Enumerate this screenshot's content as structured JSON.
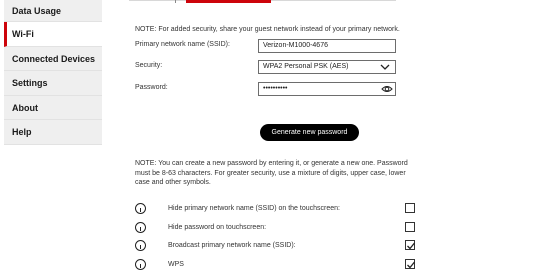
{
  "sidebar": {
    "items": [
      {
        "label": "Data Usage"
      },
      {
        "label": "Wi-Fi"
      },
      {
        "label": "Connected Devices"
      },
      {
        "label": "Settings"
      },
      {
        "label": "About"
      },
      {
        "label": "Help"
      }
    ],
    "active": "Wi-Fi"
  },
  "colors": {
    "accent": "#cd040b",
    "button_bg": "#000000"
  },
  "main": {
    "note_top": "NOTE: For added security, share your guest network instead of your primary network.",
    "ssid_label": "Primary network name (SSID):",
    "ssid_value": "Verizon-M1000-4676",
    "security_label": "Security:",
    "security_value": "WPA2 Personal PSK (AES)",
    "password_label": "Password:",
    "password_value": "••••••••••",
    "generate_label": "Generate new password",
    "note_bottom": [
      "NOTE: You can create a new password by entering it, or generate a new one. Password",
      "must be 8-63 characters. For greater security, use a mixture of digits, upper case, lower",
      "case and other symbols."
    ],
    "options": [
      {
        "label": "Hide primary network name (SSID) on the touchscreen:",
        "checked": false
      },
      {
        "label": "Hide password on touchscreen:",
        "checked": false
      },
      {
        "label": "Broadcast primary network name (SSID):",
        "checked": true
      },
      {
        "label": "WPS",
        "checked": true
      }
    ]
  },
  "icons": {
    "select_chevron": "chevron-down-icon",
    "password_reveal": "eye-icon",
    "option_info": "info-icon",
    "checkmark": "check-icon"
  }
}
